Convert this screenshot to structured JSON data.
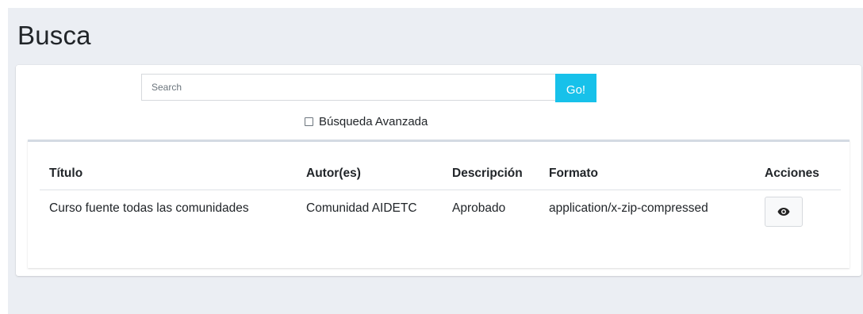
{
  "page": {
    "title": "Busca"
  },
  "search": {
    "placeholder": "Search",
    "value": "",
    "go_label": "Go!"
  },
  "advanced": {
    "label": "Búsqueda Avanzada",
    "checked": false
  },
  "table": {
    "headers": [
      "Título",
      "Autor(es)",
      "Descripción",
      "Formato",
      "Acciones"
    ],
    "rows": [
      {
        "titulo": "Curso fuente todas las comunidades",
        "autor": "Comunidad AIDETC",
        "descripcion": "Aprobado",
        "formato": "application/x-zip-compressed",
        "action_icon": "eye-icon"
      }
    ]
  },
  "colors": {
    "accent": "#17c1ea",
    "background": "#ebeef3"
  }
}
